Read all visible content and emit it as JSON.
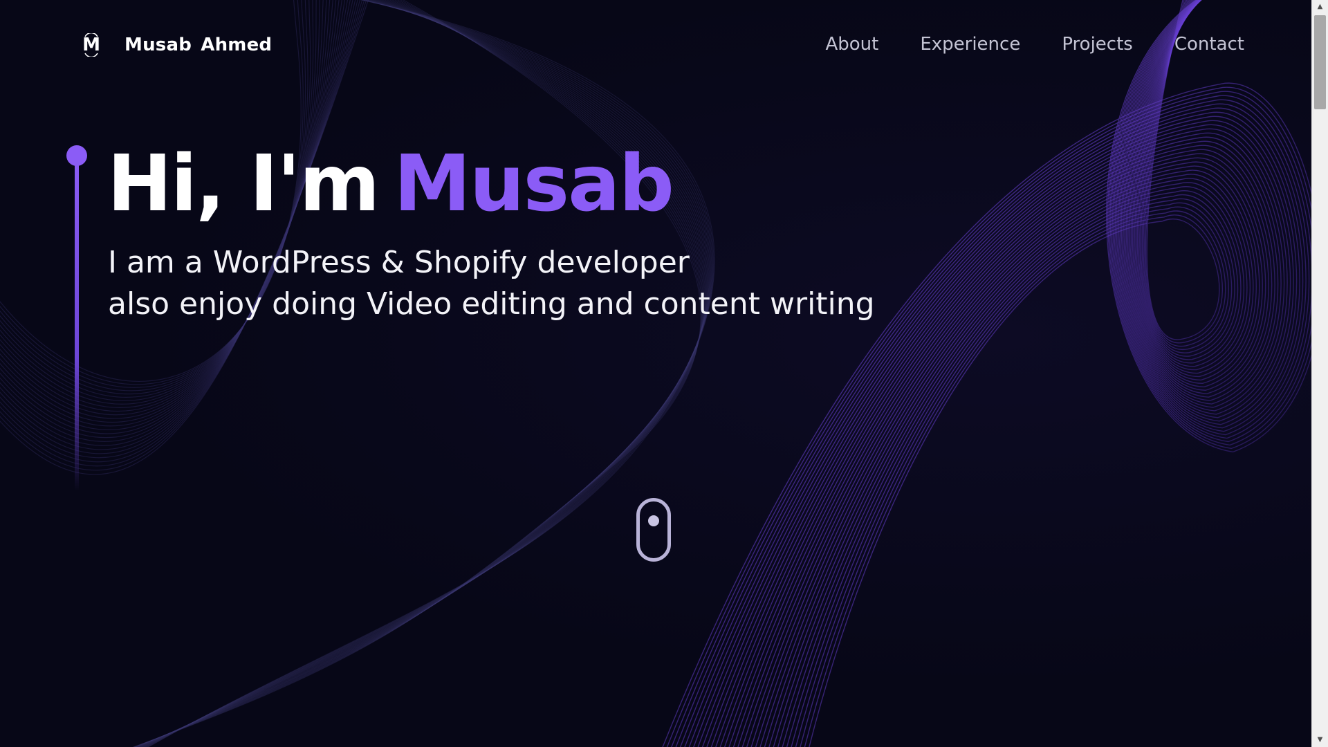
{
  "header": {
    "logo_letter": "M",
    "brand_name": "Musab Ahmed",
    "nav": [
      {
        "label": "About"
      },
      {
        "label": "Experience"
      },
      {
        "label": "Projects"
      },
      {
        "label": "Contact"
      }
    ]
  },
  "hero": {
    "greeting": "Hi, I'm",
    "name": "Musab",
    "subtitle_line1": "I am a WordPress & Shopify developer",
    "subtitle_line2": "also enjoy doing Video editing and content writing"
  },
  "icons": {
    "scroll": "mouse-scroll-icon",
    "scrollbar_up": "▲",
    "scrollbar_down": "▼"
  },
  "colors": {
    "background": "#070717",
    "accent": "#8b5cf6",
    "text": "#ffffff",
    "nav_text": "#c4c4d4"
  }
}
